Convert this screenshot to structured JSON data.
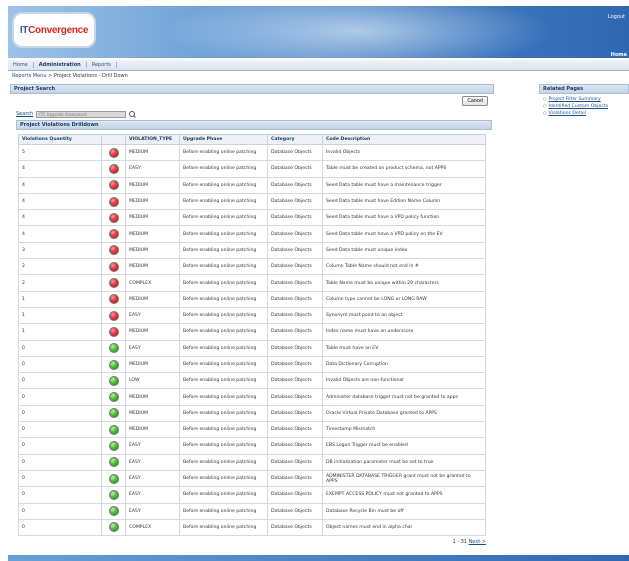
{
  "header": {
    "logo_it": "IT",
    "logo_conv": "Convergence",
    "logout": "Logout",
    "home": "Home"
  },
  "nav": {
    "home": "Home",
    "administration": "Administration",
    "reports": "Reports"
  },
  "breadcrumb": {
    "root": "Reports Menu",
    "separator": ">",
    "current": "Project Violations - Drill Down"
  },
  "project_search": {
    "title": "Project Search",
    "cancel": "Cancel",
    "search_label": "Search",
    "search_value": "ITC Upgrade Assesment"
  },
  "drilldown": {
    "title": "Project Violations Drilldown",
    "columns": [
      "Violations Quantity",
      "",
      "VIOLATION_TYPE",
      "Upgrade Phase",
      "Category",
      "Code Description"
    ],
    "rows": [
      {
        "qty": "5",
        "status": "red",
        "type": "MEDIUM",
        "phase": "Before enabling online patching",
        "category": "Database Objects",
        "desc": "Invalid Objects"
      },
      {
        "qty": "4",
        "status": "red",
        "type": "EASY",
        "phase": "Before enabling online patching",
        "category": "Database Objects",
        "desc": "Table must be created on product schema, not APPS"
      },
      {
        "qty": "4",
        "status": "red",
        "type": "MEDIUM",
        "phase": "Before enabling online patching",
        "category": "Database Objects",
        "desc": "Seed Data table must have a maintenance trigger"
      },
      {
        "qty": "4",
        "status": "red",
        "type": "MEDIUM",
        "phase": "Before enabling online patching",
        "category": "Database Objects",
        "desc": "Seed Data table must have Edition Name Column"
      },
      {
        "qty": "4",
        "status": "red",
        "type": "MEDIUM",
        "phase": "Before enabling online patching",
        "category": "Database Objects",
        "desc": "Seed Data table must have a VPD policy function"
      },
      {
        "qty": "4",
        "status": "red",
        "type": "MEDIUM",
        "phase": "Before enabling online patching",
        "category": "Database Objects",
        "desc": "Seed Data table must have a VPD policy on the EV"
      },
      {
        "qty": "3",
        "status": "red",
        "type": "MEDIUM",
        "phase": "Before enabling online patching",
        "category": "Database Objects",
        "desc": "Seed Data table must unique index"
      },
      {
        "qty": "2",
        "status": "red",
        "type": "MEDIUM",
        "phase": "Before enabling online patching",
        "category": "Database Objects",
        "desc": "Column Table Name should not end in #"
      },
      {
        "qty": "2",
        "status": "red",
        "type": "COMPLEX",
        "phase": "Before enabling online patching",
        "category": "Database Objects",
        "desc": "Table Name must be unique within 29 characters"
      },
      {
        "qty": "1",
        "status": "red",
        "type": "MEDIUM",
        "phase": "Before enabling online patching",
        "category": "Database Objects",
        "desc": "Column type cannot be LONG or LONG RAW"
      },
      {
        "qty": "1",
        "status": "red",
        "type": "EASY",
        "phase": "Before enabling online patching",
        "category": "Database Objects",
        "desc": "Synonym must point to an object"
      },
      {
        "qty": "1",
        "status": "red",
        "type": "MEDIUM",
        "phase": "Before enabling online patching",
        "category": "Database Objects",
        "desc": "Index name must have an underscore"
      },
      {
        "qty": "0",
        "status": "green",
        "type": "EASY",
        "phase": "Before enabling online patching",
        "category": "Database Objects",
        "desc": "Table must have an EV"
      },
      {
        "qty": "0",
        "status": "green",
        "type": "MEDIUM",
        "phase": "Before enabling online patching",
        "category": "Database Objects",
        "desc": "Data Dictionary Corruption"
      },
      {
        "qty": "0",
        "status": "green",
        "type": "LOW",
        "phase": "Before enabling online patching",
        "category": "Database Objects",
        "desc": "Invalid Objects are non-functional"
      },
      {
        "qty": "0",
        "status": "green",
        "type": "MEDIUM",
        "phase": "Before enabling online patching",
        "category": "Database Objects",
        "desc": "Administer database trigger must not be granted to apps"
      },
      {
        "qty": "0",
        "status": "green",
        "type": "MEDIUM",
        "phase": "Before enabling online patching",
        "category": "Database Objects",
        "desc": "Oracle Virtual Private Database granted to APPS"
      },
      {
        "qty": "0",
        "status": "green",
        "type": "MEDIUM",
        "phase": "Before enabling online patching",
        "category": "Database Objects",
        "desc": "Timestamp Mismatch"
      },
      {
        "qty": "0",
        "status": "green",
        "type": "EASY",
        "phase": "Before enabling online patching",
        "category": "Database Objects",
        "desc": "EBS Logon Trigger must be enabled"
      },
      {
        "qty": "0",
        "status": "green",
        "type": "EASY",
        "phase": "Before enabling online patching",
        "category": "Database Objects",
        "desc": "DB initialization parameter must be set to true"
      },
      {
        "qty": "0",
        "status": "green",
        "type": "EASY",
        "phase": "Before enabling online patching",
        "category": "Database Objects",
        "desc": "ADMINISTER DATABASE TRIGGER grant must not be granted to APPS"
      },
      {
        "qty": "0",
        "status": "green",
        "type": "EASY",
        "phase": "Before enabling online patching",
        "category": "Database Objects",
        "desc": "EXEMPT ACCESS POLICY must not granted to APPS"
      },
      {
        "qty": "0",
        "status": "green",
        "type": "EASY",
        "phase": "Before enabling online patching",
        "category": "Database Objects",
        "desc": "Database Recycle Bin must be off"
      },
      {
        "qty": "0",
        "status": "green",
        "type": "COMPLEX",
        "phase": "Before enabling online patching",
        "category": "Database Objects",
        "desc": "Object names must end in alpha char"
      }
    ],
    "pager_range": "1 - 31",
    "pager_next": "Next >"
  },
  "related": {
    "title": "Related Pages",
    "links": [
      "Project Filter Summary",
      "Identified Custom Objects",
      "Violations Detail"
    ]
  }
}
